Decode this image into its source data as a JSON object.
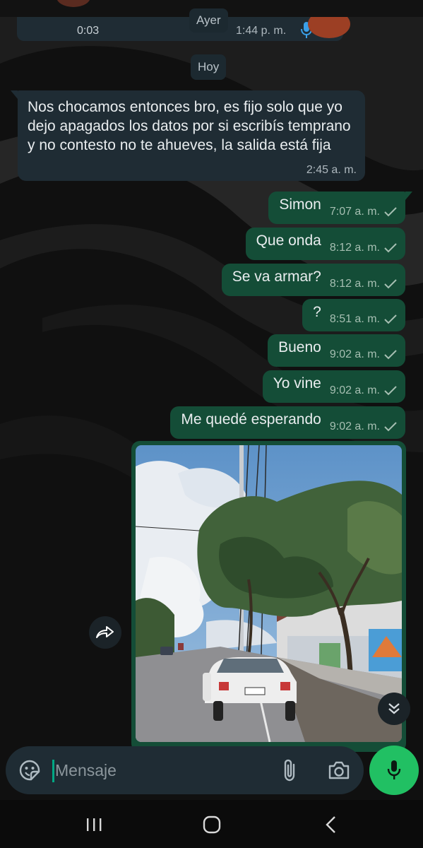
{
  "previous_audio_message": {
    "duration": "0:03",
    "time": "1:44 p. m."
  },
  "date_chips": {
    "yesterday": "Ayer",
    "today": "Hoy"
  },
  "incoming_message": {
    "text": "Nos chocamos entonces bro, es fijo solo que yo dejo apagados los datos por si escribís temprano y no contesto no te ahueves, la salida está fija",
    "time": "2:45 a. m."
  },
  "outgoing_messages": [
    {
      "text": "Simon",
      "time": "7:07 a. m."
    },
    {
      "text": "Que onda",
      "time": "8:12 a. m."
    },
    {
      "text": "Se va armar?",
      "time": "8:12 a. m."
    },
    {
      "text": "?",
      "time": "8:51 a. m."
    },
    {
      "text": "Bueno",
      "time": "9:02 a. m."
    },
    {
      "text": "Yo vine",
      "time": "9:02 a. m."
    },
    {
      "text": "Me quedé esperando",
      "time": "9:02 a. m."
    }
  ],
  "composer": {
    "placeholder": "Mensaje"
  },
  "icons": {
    "emoji": "sticker-icon",
    "attach": "paperclip-icon",
    "camera": "camera-icon",
    "mic": "mic-icon",
    "forward": "forward-icon",
    "scroll": "double-chevron-down-icon",
    "status": "single-check-icon"
  },
  "colors": {
    "incoming_bubble": "#1f2c34",
    "outgoing_bubble": "#144d37",
    "accent_green": "#21c063",
    "background": "#0b0b0b"
  }
}
